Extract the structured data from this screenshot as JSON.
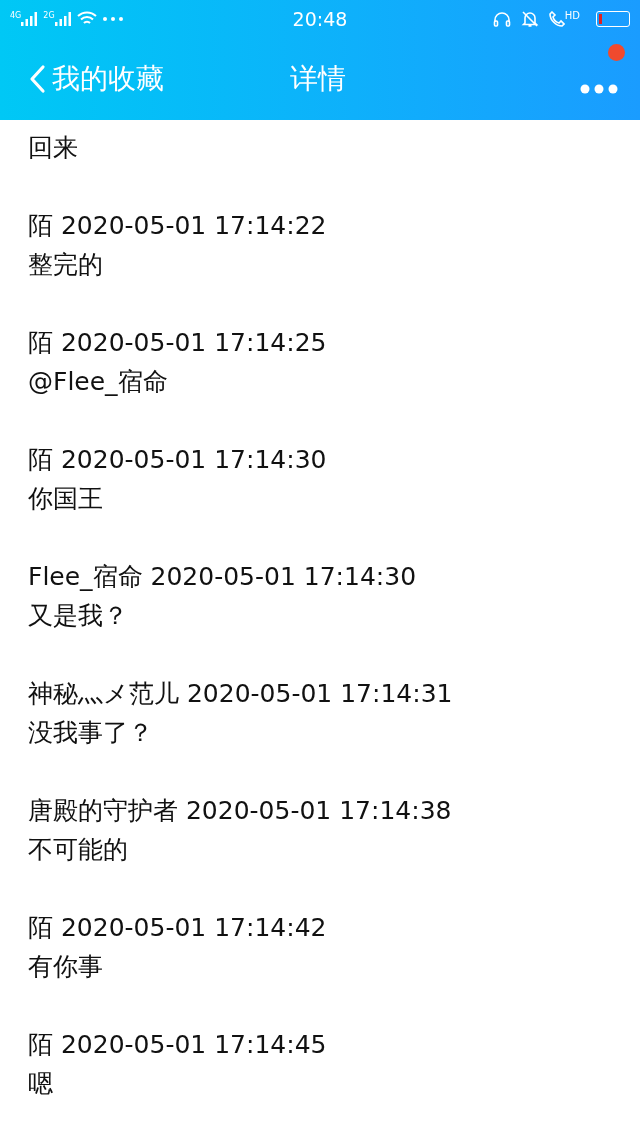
{
  "status_bar": {
    "network_1": "4G",
    "network_2": "2G",
    "time": "20:48",
    "call_label": "HD"
  },
  "nav": {
    "back_label": "我的收藏",
    "title": "详情",
    "more_badge": true
  },
  "messages": [
    {
      "text": "回来"
    },
    {
      "sender": "陌",
      "time": "2020-05-01 17:14:22",
      "text": "整完的"
    },
    {
      "sender": "陌",
      "time": "2020-05-01 17:14:25",
      "text": "@Flee_宿命"
    },
    {
      "sender": "陌",
      "time": "2020-05-01 17:14:30",
      "text": "你国王"
    },
    {
      "sender": "Flee_宿命",
      "time": "2020-05-01 17:14:30",
      "text": "又是我？"
    },
    {
      "sender": "神秘灬メ范儿",
      "time": "2020-05-01 17:14:31",
      "text": "没我事了？"
    },
    {
      "sender": "唐殿的守护者",
      "time": "2020-05-01 17:14:38",
      "text": "不可能的"
    },
    {
      "sender": "陌",
      "time": "2020-05-01 17:14:42",
      "text": "有你事"
    },
    {
      "sender": "陌",
      "time": "2020-05-01 17:14:45",
      "text": "嗯"
    }
  ]
}
